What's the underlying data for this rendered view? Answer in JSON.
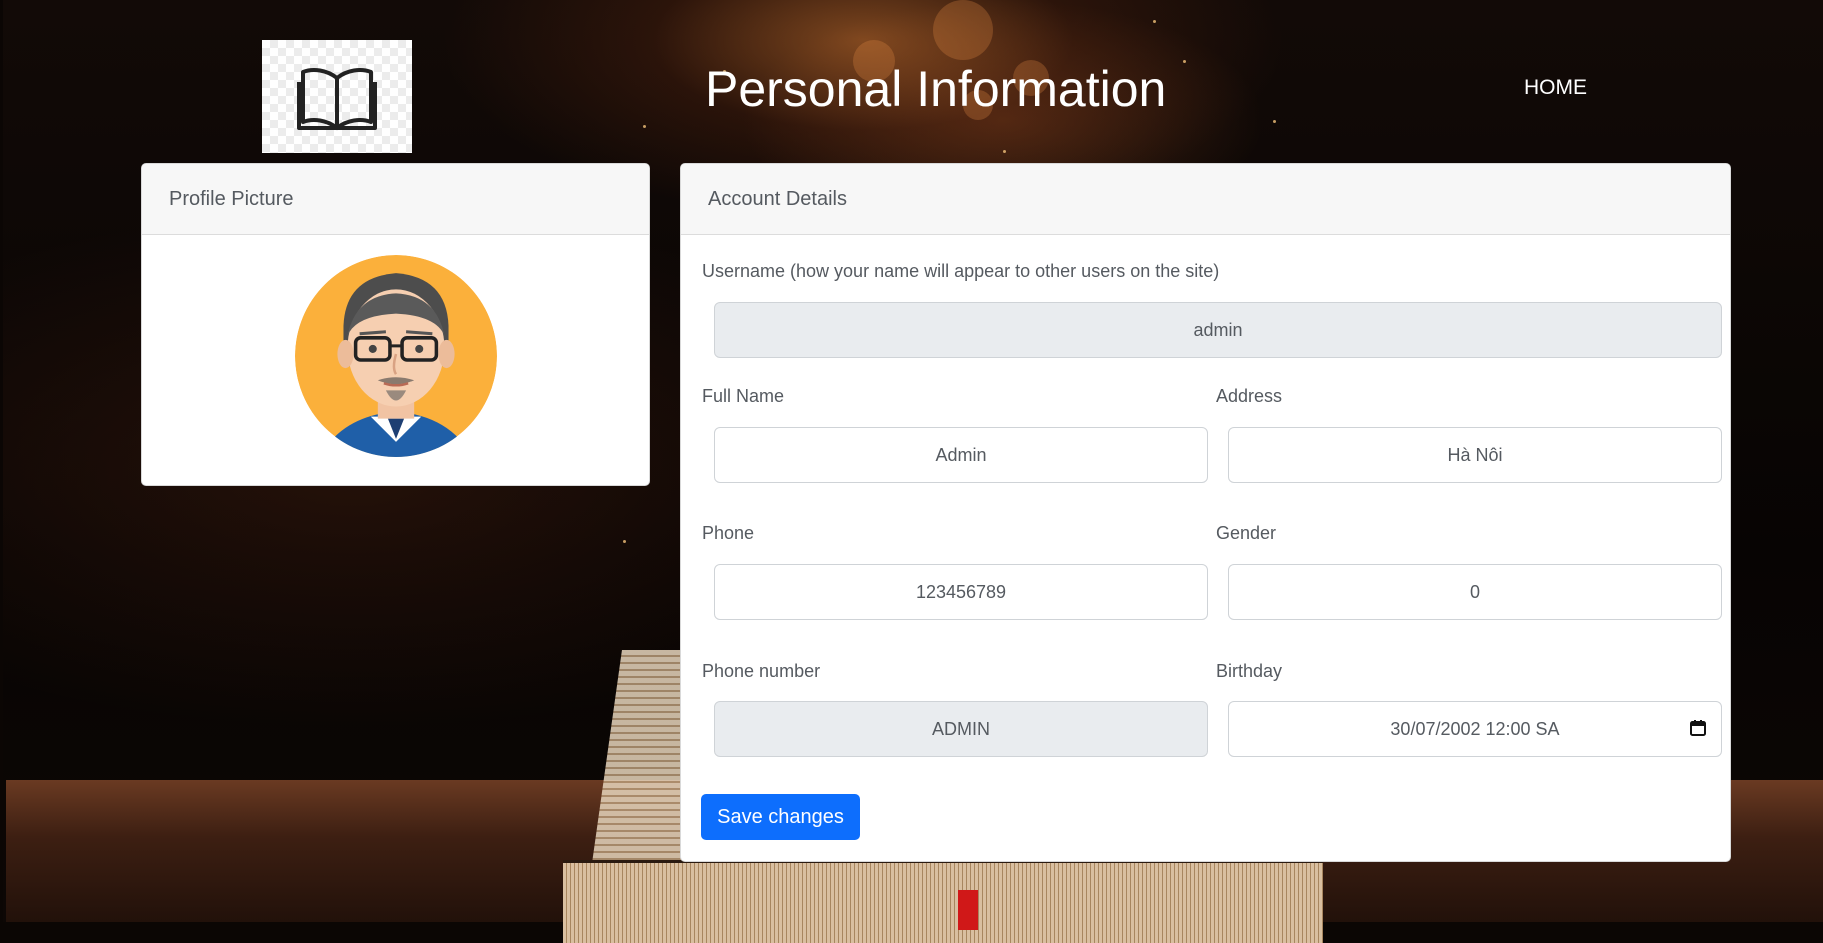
{
  "header": {
    "title": "Personal Information",
    "home_link": "HOME",
    "logo_icon": "open-book-icon"
  },
  "profile_card": {
    "title": "Profile Picture",
    "avatar_icon": "avatar-man-glasses"
  },
  "account_card": {
    "title": "Account Details",
    "username": {
      "label": "Username (how your name will appear to other users on the site)",
      "value": "admin"
    },
    "full_name": {
      "label": "Full Name",
      "value": "Admin"
    },
    "address": {
      "label": "Address",
      "value": "Hà Nôi"
    },
    "phone": {
      "label": "Phone",
      "value": "123456789"
    },
    "gender": {
      "label": "Gender",
      "value": "0"
    },
    "phone_number": {
      "label": "Phone number",
      "value": "ADMIN"
    },
    "birthday": {
      "label": "Birthday",
      "value": "30/07/2002 12:00  SA"
    },
    "save_label": "Save changes"
  },
  "colors": {
    "primary": "#0d6efd",
    "readonly_bg": "#e9ecef",
    "card_header_bg": "#f7f7f7",
    "avatar_bg": "#fbb03b"
  }
}
